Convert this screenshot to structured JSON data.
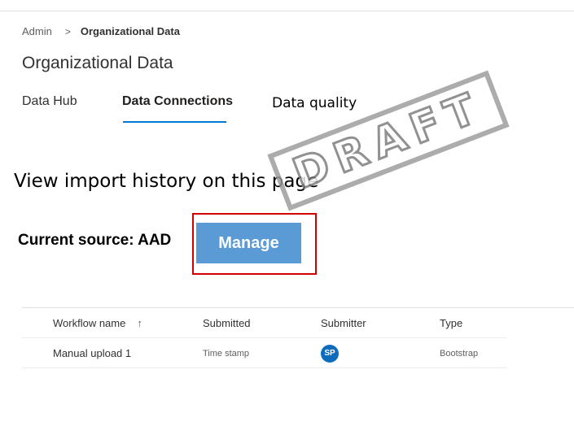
{
  "breadcrumb": {
    "parent": "Admin",
    "separator": ">",
    "current": "Organizational Data"
  },
  "page": {
    "title": "Organizational Data"
  },
  "tabs": [
    {
      "label": "Data Hub"
    },
    {
      "label": "Data Connections",
      "selected": true
    },
    {
      "label": "Data quality"
    }
  ],
  "stamp": {
    "text": "DRAFT"
  },
  "import_note": "View import history on this page",
  "source": {
    "label": "Current source: AAD"
  },
  "manage_button": {
    "label": "Manage"
  },
  "table": {
    "columns": [
      "Workflow name",
      "Submitted",
      "Submitter",
      "Type"
    ],
    "sort_indicator": "↑",
    "rows": [
      {
        "workflow_name": "Manual upload 1",
        "submitted": "Time stamp",
        "submitter_initials": "SP",
        "type": "Bootstrap"
      }
    ]
  },
  "colors": {
    "accent": "#0078d4",
    "button": "#5b9bd5",
    "highlight_border": "#d00000",
    "avatar": "#0f6cbd"
  }
}
